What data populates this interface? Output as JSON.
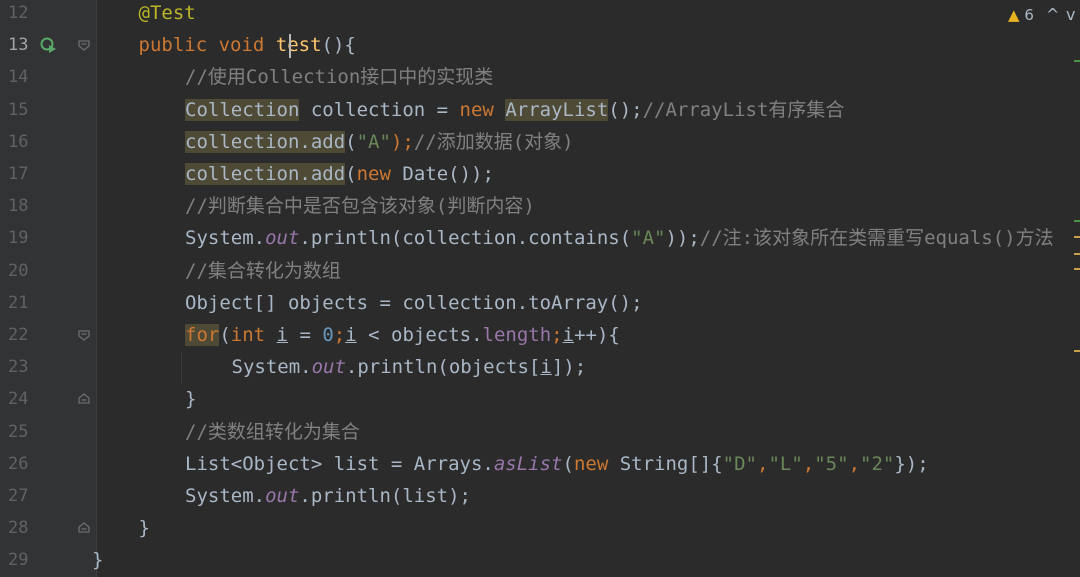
{
  "editor": {
    "inspection": {
      "warning_count": "6",
      "nav_up": "^",
      "nav_down": "v"
    },
    "lines": [
      {
        "number": "12",
        "indent": 1,
        "tokens": [
          {
            "t": "@Test",
            "c": "ann"
          }
        ]
      },
      {
        "number": "13",
        "indent": 1,
        "current": true,
        "tokens": [
          {
            "t": "public ",
            "c": "kw"
          },
          {
            "t": "void ",
            "c": "kw"
          },
          {
            "t": "test",
            "c": "fn"
          },
          {
            "t": "(){",
            "c": "plain"
          }
        ]
      },
      {
        "number": "14",
        "indent": 2,
        "tokens": [
          {
            "t": "//使用Collection接口中的实现类",
            "c": "cmt"
          }
        ]
      },
      {
        "number": "15",
        "indent": 2,
        "tokens": [
          {
            "t": "Collection",
            "c": "plain",
            "hl": true
          },
          {
            "t": " collection = ",
            "c": "plain"
          },
          {
            "t": "new ",
            "c": "kw"
          },
          {
            "t": "ArrayList",
            "c": "plain",
            "hl": true
          },
          {
            "t": "();",
            "c": "plain"
          },
          {
            "t": "//ArrayList有序集合",
            "c": "cmt"
          }
        ]
      },
      {
        "number": "16",
        "indent": 2,
        "tokens": [
          {
            "t": "collection.add",
            "c": "plain",
            "hl": true
          },
          {
            "t": "(",
            "c": "plain"
          },
          {
            "t": "\"A\"",
            "c": "str"
          },
          {
            "t": ");",
            "c": "kw"
          },
          {
            "t": "//添加数据(对象)",
            "c": "cmt"
          }
        ]
      },
      {
        "number": "17",
        "indent": 2,
        "tokens": [
          {
            "t": "collection.add",
            "c": "plain",
            "hl": true
          },
          {
            "t": "(",
            "c": "plain"
          },
          {
            "t": "new ",
            "c": "kw"
          },
          {
            "t": "Date());",
            "c": "plain"
          }
        ]
      },
      {
        "number": "18",
        "indent": 2,
        "tokens": [
          {
            "t": "//判断集合中是否包含该对象(判断内容)",
            "c": "cmt"
          }
        ]
      },
      {
        "number": "19",
        "indent": 2,
        "tokens": [
          {
            "t": "System.",
            "c": "plain"
          },
          {
            "t": "out",
            "c": "fld"
          },
          {
            "t": ".println(collection.contains(",
            "c": "plain"
          },
          {
            "t": "\"A\"",
            "c": "str"
          },
          {
            "t": "));",
            "c": "plain"
          },
          {
            "t": "//注:该对象所在类需重写equals()方法",
            "c": "cmt"
          }
        ]
      },
      {
        "number": "20",
        "indent": 2,
        "tokens": [
          {
            "t": "//集合转化为数组",
            "c": "cmt"
          }
        ]
      },
      {
        "number": "21",
        "indent": 2,
        "tokens": [
          {
            "t": "Object[] objects = collection.toArray();",
            "c": "plain"
          }
        ]
      },
      {
        "number": "22",
        "indent": 2,
        "tokens": [
          {
            "t": "for",
            "c": "kw",
            "hl": true
          },
          {
            "t": "(",
            "c": "plain"
          },
          {
            "t": "int ",
            "c": "kw"
          },
          {
            "t": "i",
            "c": "plain",
            "ul": true
          },
          {
            "t": " = ",
            "c": "plain"
          },
          {
            "t": "0",
            "c": "num"
          },
          {
            "t": ";",
            "c": "kw"
          },
          {
            "t": "i",
            "c": "plain",
            "ul": true
          },
          {
            "t": " < objects.",
            "c": "plain"
          },
          {
            "t": "length",
            "c": "prop"
          },
          {
            "t": ";",
            "c": "kw"
          },
          {
            "t": "i",
            "c": "plain",
            "ul": true
          },
          {
            "t": "++){",
            "c": "plain"
          }
        ]
      },
      {
        "number": "23",
        "indent": 3,
        "tokens": [
          {
            "t": "System.",
            "c": "plain"
          },
          {
            "t": "out",
            "c": "fld"
          },
          {
            "t": ".println(objects[",
            "c": "plain"
          },
          {
            "t": "i",
            "c": "plain",
            "ul": true
          },
          {
            "t": "]);",
            "c": "plain"
          }
        ]
      },
      {
        "number": "24",
        "indent": 2,
        "tokens": [
          {
            "t": "}",
            "c": "plain"
          }
        ]
      },
      {
        "number": "25",
        "indent": 2,
        "tokens": [
          {
            "t": "//类数组转化为集合",
            "c": "cmt"
          }
        ]
      },
      {
        "number": "26",
        "indent": 2,
        "tokens": [
          {
            "t": "List<Object> list = Arrays.",
            "c": "plain"
          },
          {
            "t": "asList",
            "c": "fld"
          },
          {
            "t": "(",
            "c": "plain"
          },
          {
            "t": "new ",
            "c": "kw"
          },
          {
            "t": "String[]{",
            "c": "plain"
          },
          {
            "t": "\"D\"",
            "c": "str"
          },
          {
            "t": ",",
            "c": "kw"
          },
          {
            "t": "\"L\"",
            "c": "str"
          },
          {
            "t": ",",
            "c": "kw"
          },
          {
            "t": "\"5\"",
            "c": "str"
          },
          {
            "t": ",",
            "c": "kw"
          },
          {
            "t": "\"2\"",
            "c": "str"
          },
          {
            "t": "});",
            "c": "plain"
          }
        ]
      },
      {
        "number": "27",
        "indent": 2,
        "tokens": [
          {
            "t": "System.",
            "c": "plain"
          },
          {
            "t": "out",
            "c": "fld"
          },
          {
            "t": ".println(list);",
            "c": "plain"
          }
        ]
      },
      {
        "number": "28",
        "indent": 1,
        "tokens": [
          {
            "t": "}",
            "c": "plain"
          }
        ]
      },
      {
        "number": "29",
        "indent": 0,
        "tokens": [
          {
            "t": "}",
            "c": "plain"
          }
        ]
      }
    ]
  },
  "colors": {
    "background": "#2b2b2b",
    "gutter": "#313335",
    "keyword": "#cc7832",
    "string": "#6a8759",
    "comment": "#808080",
    "annotation": "#bbb529",
    "method_declaration": "#ffc66d",
    "static_field": "#9876aa",
    "number": "#6897bb",
    "warning": "#e6b422",
    "run_icon": "#59a869"
  }
}
